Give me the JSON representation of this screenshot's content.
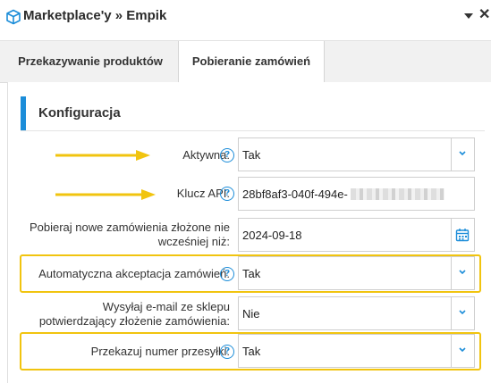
{
  "header": {
    "title": "Marketplace'y » Empik",
    "collapse_icon": "caret-down-icon",
    "close_label": "✕"
  },
  "tabs": [
    {
      "label": "Przekazywanie produktów",
      "active": false
    },
    {
      "label": "Pobieranie zamówień",
      "active": true
    }
  ],
  "section": {
    "title": "Konfiguracja"
  },
  "fields": [
    {
      "label": "Aktywna:",
      "value": "Tak",
      "type": "select"
    },
    {
      "label": "Klucz API:",
      "value": "28bf8af3-040f-494e-",
      "type": "text"
    },
    {
      "label": "Pobieraj nowe zamówienia złożone nie wcześniej niż:",
      "value": "2024-09-18",
      "type": "date"
    },
    {
      "label": "Automatyczna akceptacja zamówień:",
      "value": "Tak",
      "type": "select"
    },
    {
      "label": "Wysyłaj e-mail ze sklepu potwierdzający złożenie zamówienia:",
      "value": "Nie",
      "type": "select"
    },
    {
      "label": "Przekazuj numer przesyłki:",
      "value": "Tak",
      "type": "select"
    }
  ],
  "help_glyph": "?",
  "colors": {
    "accent": "#1c8dd9",
    "highlight": "#f1c40f"
  }
}
